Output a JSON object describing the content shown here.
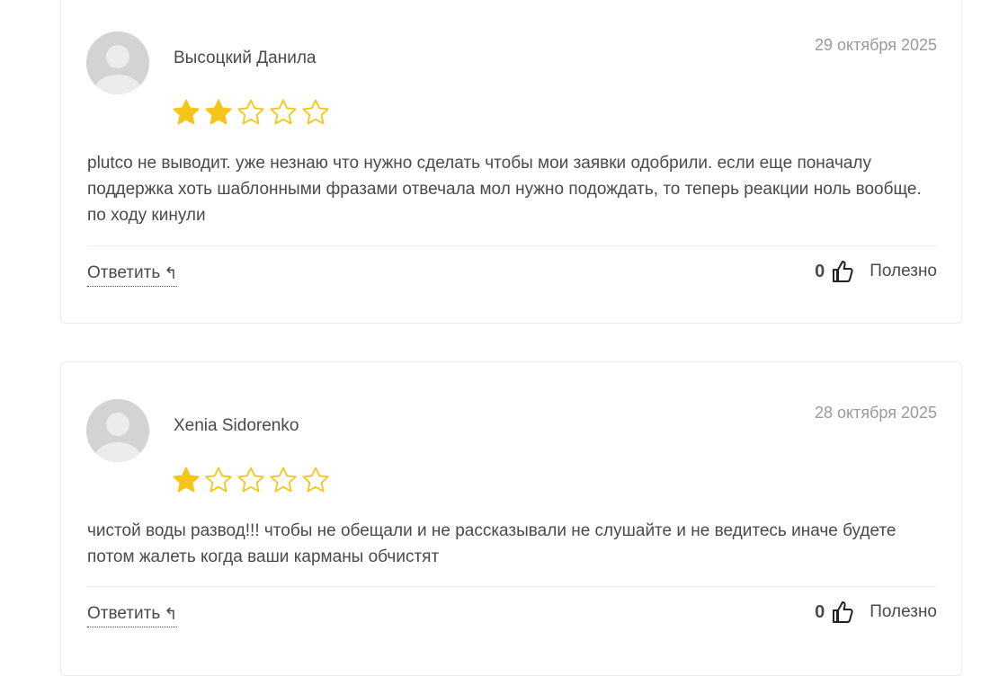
{
  "reviews": [
    {
      "author": "Высоцкий Данила",
      "date": "29 октября 2025",
      "rating": 2,
      "max_rating": 5,
      "text": "plutco не выводит. уже незнаю что нужно сделать чтобы мои заявки одобрили. если еще поначалу поддержка хоть шаблонными фразами отвечала мол нужно подождать, то теперь реакции ноль вообще. по ходу кинули",
      "reply_label": "Ответить",
      "reply_arrow": "↰",
      "likes": "0",
      "helpful_label": "Полезно"
    },
    {
      "author": "Xenia Sidorenko",
      "date": "28 октября 2025",
      "rating": 1,
      "max_rating": 5,
      "text": "чистой воды развод!!! чтобы не обещали и не рассказывали не слушайте и не ведитесь иначе будете потом жалеть когда ваши карманы обчистят",
      "reply_label": "Ответить",
      "reply_arrow": "↰",
      "likes": "0",
      "helpful_label": "Полезно"
    }
  ],
  "colors": {
    "star_filled": "#f5c518",
    "star_outline": "#f5c518",
    "avatar_bg": "#d3d3d3",
    "avatar_fg": "#ececec",
    "date": "#9a9a9a",
    "text": "#4a4a4a"
  },
  "icons": {
    "avatar": "user-avatar-placeholder-icon",
    "star": "star-icon",
    "thumb": "thumbs-up-icon",
    "reply": "reply-arrow-icon"
  }
}
